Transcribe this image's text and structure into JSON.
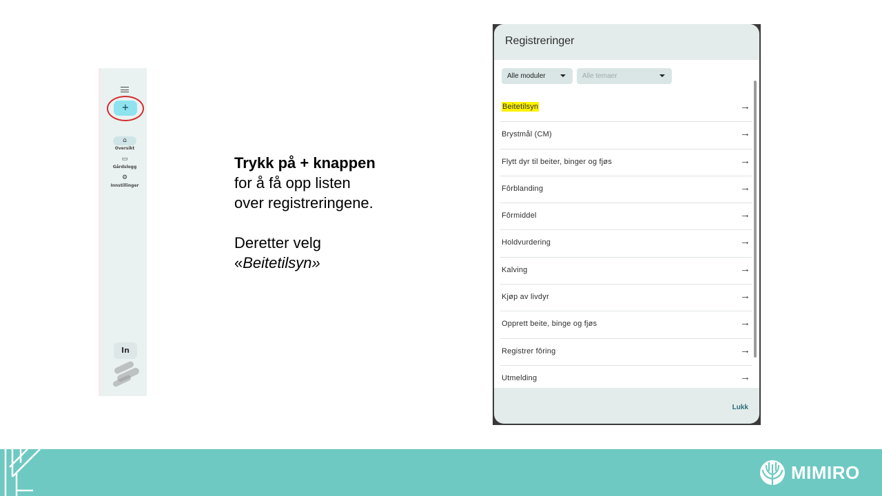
{
  "sidebar": {
    "add_label": "+",
    "items": [
      {
        "label": "Oversikt",
        "icon": "home-icon",
        "glyph": "⌂"
      },
      {
        "label": "Gårdslogg",
        "icon": "logbook-icon",
        "glyph": "▭"
      },
      {
        "label": "Innstillinger",
        "icon": "settings-icon",
        "glyph": "⚙"
      }
    ],
    "in_label": "In"
  },
  "instructions": {
    "line1": "Trykk på + knappen",
    "line2": "for å få opp listen",
    "line3": "over registreringene.",
    "line4": "Deretter velg",
    "line5_prefix": "«",
    "line5_italic": "Beitetilsyn»"
  },
  "dialog": {
    "title": "Registreringer",
    "filters": {
      "modules": "Alle moduler",
      "themes": "Alle temaer"
    },
    "items": [
      "Beitetilsyn",
      "Brystmål (CM)",
      "Flytt dyr til beiter, binger og fjøs",
      "Fôrblanding",
      "Fôrmiddel",
      "Holdvurdering",
      "Kalving",
      "Kjøp av livdyr",
      "Opprett beite, binge og fjøs",
      "Registrer fôring",
      "Utmelding"
    ],
    "highlighted_item": "Beitetilsyn",
    "highlight_color": "#fff200",
    "close_label": "Lukk"
  },
  "footer": {
    "brand": "MIMIRO",
    "color": "#6ec9c2"
  }
}
